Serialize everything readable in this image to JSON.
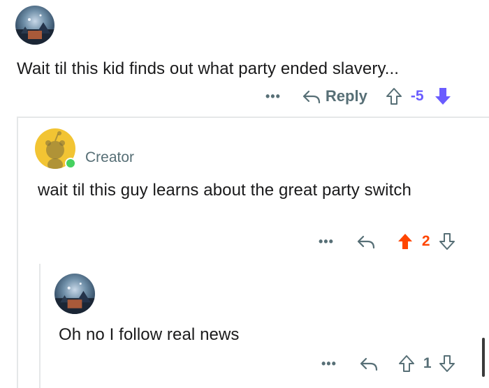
{
  "comments": [
    {
      "author_label": "",
      "text": "Wait til this kid finds out what party ended slavery...",
      "more_label": "•••",
      "reply_label": "Reply",
      "vote_count": "-5",
      "vote_state": "downvoted"
    },
    {
      "author_label": "Creator",
      "text": "wait til this guy learns about the great party switch",
      "more_label": "•••",
      "vote_count": "2",
      "vote_state": "upvoted"
    },
    {
      "author_label": "",
      "text": "Oh no I follow real news",
      "more_label": "•••",
      "vote_count": "1",
      "vote_state": "none"
    }
  ],
  "colors": {
    "downvote": "#6a5cff",
    "upvote": "#ff4500",
    "neutral": "#576f76",
    "online": "#46d160"
  },
  "icons": [
    "more-icon",
    "reply-icon",
    "upvote-arrow-icon",
    "downvote-arrow-icon",
    "online-indicator"
  ]
}
